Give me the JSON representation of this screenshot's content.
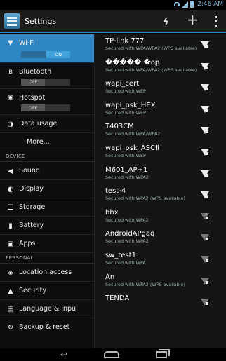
{
  "status_bar": {
    "time": "2:46 AM"
  },
  "action_bar": {
    "title": "Settings",
    "wps_icon": "wps-push-icon",
    "add_icon": "add-network-icon",
    "overflow_icon": "overflow-menu-icon"
  },
  "settings_menu": {
    "items": [
      {
        "label": "Wi-Fi",
        "icon": "wifi-icon",
        "toggle": "ON"
      },
      {
        "label": "Bluetooth",
        "icon": "bluetooth-icon",
        "toggle": "OFF"
      },
      {
        "label": "Hotspot",
        "icon": "hotspot-icon",
        "toggle": "OFF"
      },
      {
        "label": "Data usage",
        "icon": "data-usage-icon"
      },
      {
        "label": "More..."
      }
    ],
    "device_header": "DEVICE",
    "device_items": [
      {
        "label": "Sound",
        "icon": "sound-icon"
      },
      {
        "label": "Display",
        "icon": "display-icon"
      },
      {
        "label": "Storage",
        "icon": "storage-icon"
      },
      {
        "label": "Battery",
        "icon": "battery-icon"
      },
      {
        "label": "Apps",
        "icon": "apps-icon"
      }
    ],
    "personal_header": "PERSONAL",
    "personal_items": [
      {
        "label": "Location access",
        "icon": "location-icon"
      },
      {
        "label": "Security",
        "icon": "security-lock-icon"
      },
      {
        "label": "Language & inpu",
        "icon": "language-icon"
      },
      {
        "label": "Backup & reset",
        "icon": "backup-icon"
      }
    ]
  },
  "networks": [
    {
      "name": "TP-link 777",
      "security": "Secured with WPA/WPA2 (WPS available)"
    },
    {
      "name": "����� �op",
      "security": "Secured with WPA/WPA2 (WPS available)"
    },
    {
      "name": "wapi_cert",
      "security": "Secured with WEP"
    },
    {
      "name": "wapi_psk_HEX",
      "security": "Secured with WEP"
    },
    {
      "name": "T403CM",
      "security": "Secured with WPA/WPA2"
    },
    {
      "name": "wapi_psk_ASCII",
      "security": "Secured with WEP"
    },
    {
      "name": "M601_AP+1",
      "security": "Secured with WPA2"
    },
    {
      "name": "test-4",
      "security": "Secured with WPA2 (WPS available)"
    },
    {
      "name": "hhx",
      "security": "Secured with WPA2"
    },
    {
      "name": "AndroidAPgaq",
      "security": "Secured with WPA2"
    },
    {
      "name": "sw_test1",
      "security": "Secured with WPA"
    },
    {
      "name": "An",
      "security": "Secured with WPA2 (WPS available)"
    },
    {
      "name": "TENDA",
      "security": ""
    }
  ],
  "nav_bar": {
    "back_icon": "back-icon",
    "home_icon": "home-icon",
    "recents_icon": "recents-icon"
  }
}
